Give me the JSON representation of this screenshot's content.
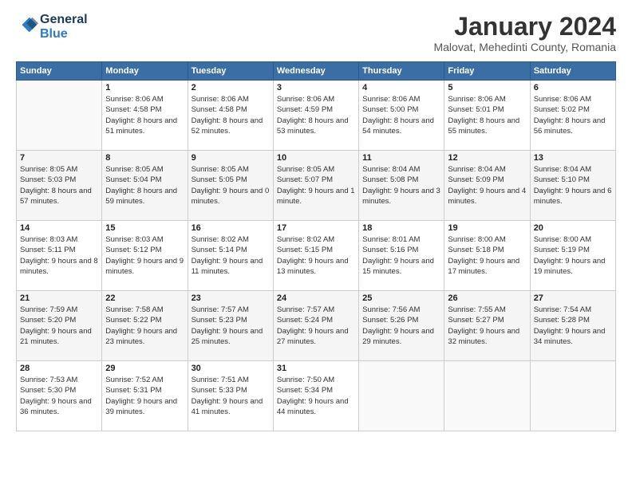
{
  "header": {
    "logo_line1": "General",
    "logo_line2": "Blue",
    "month_title": "January 2024",
    "location": "Malovat, Mehedinti County, Romania"
  },
  "days_of_week": [
    "Sunday",
    "Monday",
    "Tuesday",
    "Wednesday",
    "Thursday",
    "Friday",
    "Saturday"
  ],
  "weeks": [
    [
      {
        "day": "",
        "sunrise": "",
        "sunset": "",
        "daylight": ""
      },
      {
        "day": "1",
        "sunrise": "Sunrise: 8:06 AM",
        "sunset": "Sunset: 4:58 PM",
        "daylight": "Daylight: 8 hours and 51 minutes."
      },
      {
        "day": "2",
        "sunrise": "Sunrise: 8:06 AM",
        "sunset": "Sunset: 4:58 PM",
        "daylight": "Daylight: 8 hours and 52 minutes."
      },
      {
        "day": "3",
        "sunrise": "Sunrise: 8:06 AM",
        "sunset": "Sunset: 4:59 PM",
        "daylight": "Daylight: 8 hours and 53 minutes."
      },
      {
        "day": "4",
        "sunrise": "Sunrise: 8:06 AM",
        "sunset": "Sunset: 5:00 PM",
        "daylight": "Daylight: 8 hours and 54 minutes."
      },
      {
        "day": "5",
        "sunrise": "Sunrise: 8:06 AM",
        "sunset": "Sunset: 5:01 PM",
        "daylight": "Daylight: 8 hours and 55 minutes."
      },
      {
        "day": "6",
        "sunrise": "Sunrise: 8:06 AM",
        "sunset": "Sunset: 5:02 PM",
        "daylight": "Daylight: 8 hours and 56 minutes."
      }
    ],
    [
      {
        "day": "7",
        "sunrise": "Sunrise: 8:05 AM",
        "sunset": "Sunset: 5:03 PM",
        "daylight": "Daylight: 8 hours and 57 minutes."
      },
      {
        "day": "8",
        "sunrise": "Sunrise: 8:05 AM",
        "sunset": "Sunset: 5:04 PM",
        "daylight": "Daylight: 8 hours and 59 minutes."
      },
      {
        "day": "9",
        "sunrise": "Sunrise: 8:05 AM",
        "sunset": "Sunset: 5:05 PM",
        "daylight": "Daylight: 9 hours and 0 minutes."
      },
      {
        "day": "10",
        "sunrise": "Sunrise: 8:05 AM",
        "sunset": "Sunset: 5:07 PM",
        "daylight": "Daylight: 9 hours and 1 minute."
      },
      {
        "day": "11",
        "sunrise": "Sunrise: 8:04 AM",
        "sunset": "Sunset: 5:08 PM",
        "daylight": "Daylight: 9 hours and 3 minutes."
      },
      {
        "day": "12",
        "sunrise": "Sunrise: 8:04 AM",
        "sunset": "Sunset: 5:09 PM",
        "daylight": "Daylight: 9 hours and 4 minutes."
      },
      {
        "day": "13",
        "sunrise": "Sunrise: 8:04 AM",
        "sunset": "Sunset: 5:10 PM",
        "daylight": "Daylight: 9 hours and 6 minutes."
      }
    ],
    [
      {
        "day": "14",
        "sunrise": "Sunrise: 8:03 AM",
        "sunset": "Sunset: 5:11 PM",
        "daylight": "Daylight: 9 hours and 8 minutes."
      },
      {
        "day": "15",
        "sunrise": "Sunrise: 8:03 AM",
        "sunset": "Sunset: 5:12 PM",
        "daylight": "Daylight: 9 hours and 9 minutes."
      },
      {
        "day": "16",
        "sunrise": "Sunrise: 8:02 AM",
        "sunset": "Sunset: 5:14 PM",
        "daylight": "Daylight: 9 hours and 11 minutes."
      },
      {
        "day": "17",
        "sunrise": "Sunrise: 8:02 AM",
        "sunset": "Sunset: 5:15 PM",
        "daylight": "Daylight: 9 hours and 13 minutes."
      },
      {
        "day": "18",
        "sunrise": "Sunrise: 8:01 AM",
        "sunset": "Sunset: 5:16 PM",
        "daylight": "Daylight: 9 hours and 15 minutes."
      },
      {
        "day": "19",
        "sunrise": "Sunrise: 8:00 AM",
        "sunset": "Sunset: 5:18 PM",
        "daylight": "Daylight: 9 hours and 17 minutes."
      },
      {
        "day": "20",
        "sunrise": "Sunrise: 8:00 AM",
        "sunset": "Sunset: 5:19 PM",
        "daylight": "Daylight: 9 hours and 19 minutes."
      }
    ],
    [
      {
        "day": "21",
        "sunrise": "Sunrise: 7:59 AM",
        "sunset": "Sunset: 5:20 PM",
        "daylight": "Daylight: 9 hours and 21 minutes."
      },
      {
        "day": "22",
        "sunrise": "Sunrise: 7:58 AM",
        "sunset": "Sunset: 5:22 PM",
        "daylight": "Daylight: 9 hours and 23 minutes."
      },
      {
        "day": "23",
        "sunrise": "Sunrise: 7:57 AM",
        "sunset": "Sunset: 5:23 PM",
        "daylight": "Daylight: 9 hours and 25 minutes."
      },
      {
        "day": "24",
        "sunrise": "Sunrise: 7:57 AM",
        "sunset": "Sunset: 5:24 PM",
        "daylight": "Daylight: 9 hours and 27 minutes."
      },
      {
        "day": "25",
        "sunrise": "Sunrise: 7:56 AM",
        "sunset": "Sunset: 5:26 PM",
        "daylight": "Daylight: 9 hours and 29 minutes."
      },
      {
        "day": "26",
        "sunrise": "Sunrise: 7:55 AM",
        "sunset": "Sunset: 5:27 PM",
        "daylight": "Daylight: 9 hours and 32 minutes."
      },
      {
        "day": "27",
        "sunrise": "Sunrise: 7:54 AM",
        "sunset": "Sunset: 5:28 PM",
        "daylight": "Daylight: 9 hours and 34 minutes."
      }
    ],
    [
      {
        "day": "28",
        "sunrise": "Sunrise: 7:53 AM",
        "sunset": "Sunset: 5:30 PM",
        "daylight": "Daylight: 9 hours and 36 minutes."
      },
      {
        "day": "29",
        "sunrise": "Sunrise: 7:52 AM",
        "sunset": "Sunset: 5:31 PM",
        "daylight": "Daylight: 9 hours and 39 minutes."
      },
      {
        "day": "30",
        "sunrise": "Sunrise: 7:51 AM",
        "sunset": "Sunset: 5:33 PM",
        "daylight": "Daylight: 9 hours and 41 minutes."
      },
      {
        "day": "31",
        "sunrise": "Sunrise: 7:50 AM",
        "sunset": "Sunset: 5:34 PM",
        "daylight": "Daylight: 9 hours and 44 minutes."
      },
      {
        "day": "",
        "sunrise": "",
        "sunset": "",
        "daylight": ""
      },
      {
        "day": "",
        "sunrise": "",
        "sunset": "",
        "daylight": ""
      },
      {
        "day": "",
        "sunrise": "",
        "sunset": "",
        "daylight": ""
      }
    ]
  ]
}
